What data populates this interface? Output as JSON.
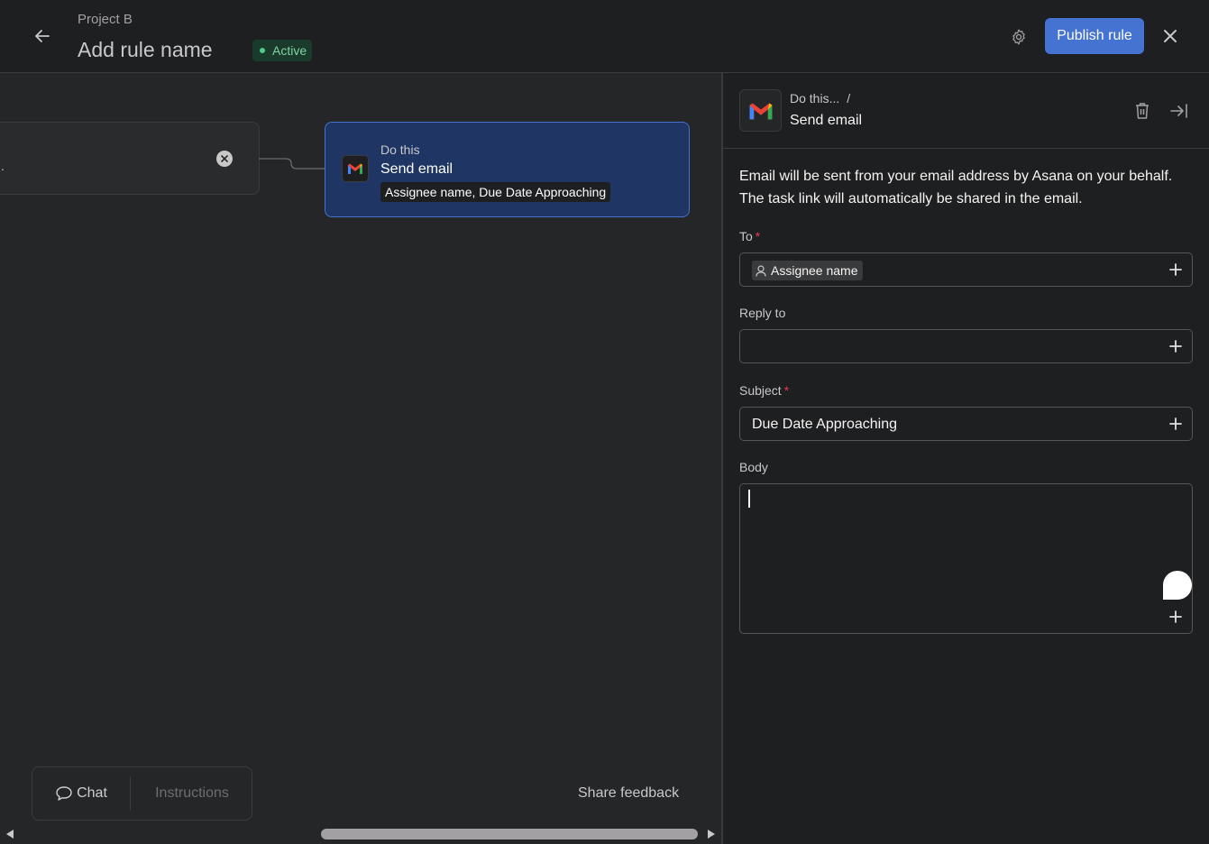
{
  "header": {
    "project": "Project B",
    "rule_name": "Add rule name",
    "status": "Active",
    "publish_label": "Publish rule"
  },
  "canvas": {
    "trigger": {
      "text": "."
    },
    "action": {
      "label": "Do this",
      "title": "Send email",
      "chip": "Assignee name, Due Date Approaching"
    },
    "chat_label": "Chat",
    "instructions_label": "Instructions",
    "feedback_label": "Share feedback"
  },
  "panel": {
    "crumb": "Do this...",
    "crumb_sep": "/",
    "title": "Send email",
    "description": "Email will be sent from your email address by Asana on your behalf. The task link will automatically be shared in the email.",
    "fields": {
      "to_label": "To",
      "to_token": "Assignee name",
      "reply_label": "Reply to",
      "subject_label": "Subject",
      "subject_value": "Due Date Approaching",
      "body_label": "Body",
      "required_mark": "*"
    }
  },
  "icons": {
    "back": "arrow-left-icon",
    "settings": "gear-icon",
    "close": "close-icon",
    "gmail": "gmail-icon",
    "trash": "trash-icon",
    "collapse": "collapse-panel-icon",
    "add": "plus-icon",
    "user": "user-icon",
    "chat": "chat-bubble-icon"
  },
  "colors": {
    "accent": "#4573d2",
    "status_green": "#4ecb8a",
    "required": "#e8384f"
  }
}
